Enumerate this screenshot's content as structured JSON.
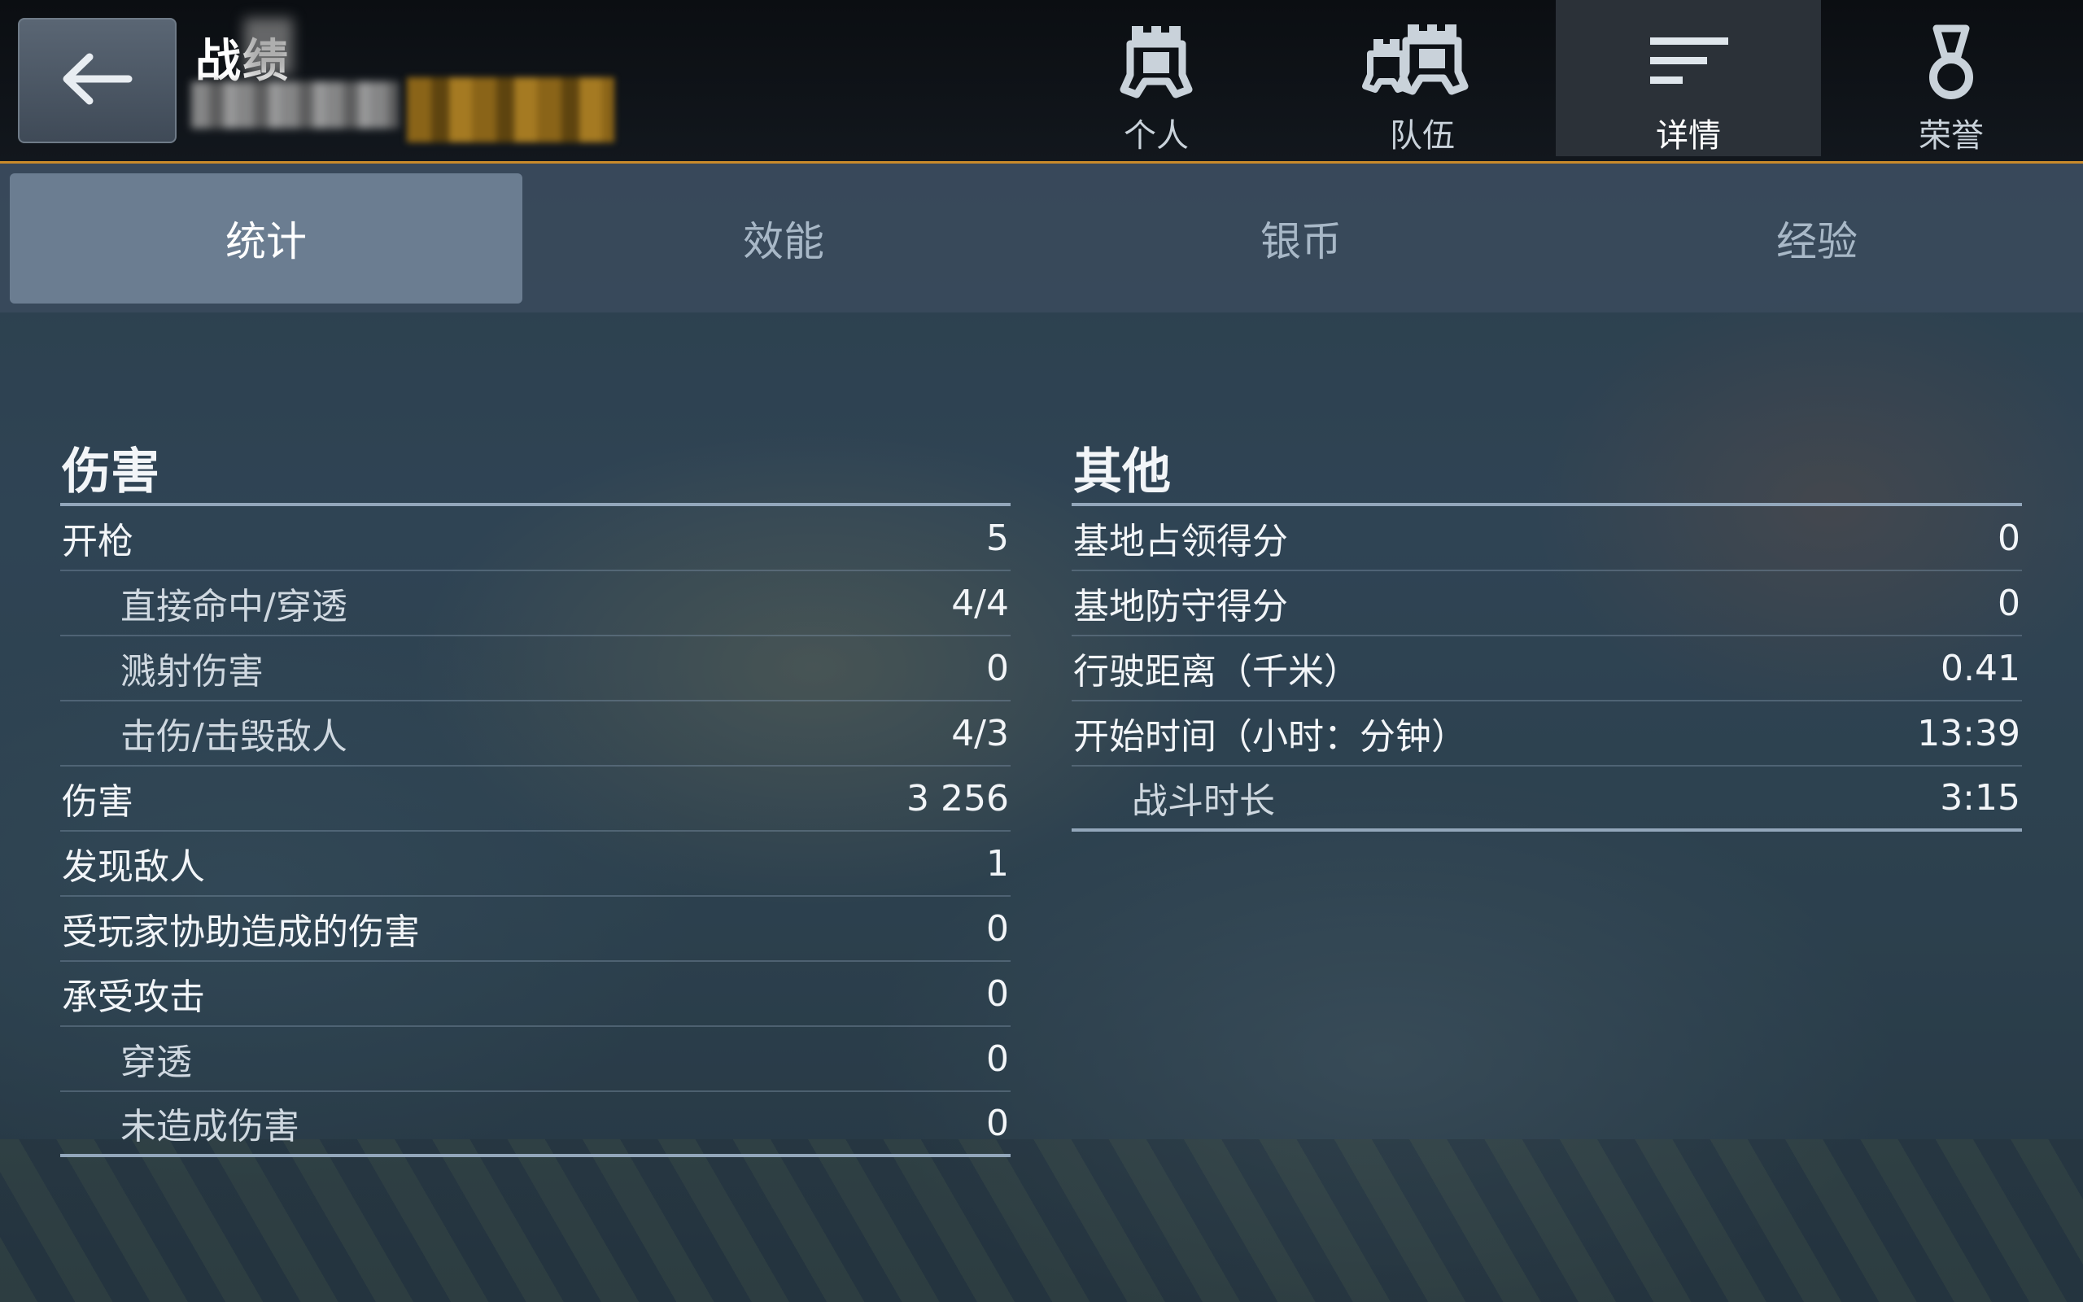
{
  "header": {
    "title": "战绩",
    "back_label": "",
    "tabs": [
      {
        "label": "个人",
        "icon": "single-player-helmet-icon",
        "active": false
      },
      {
        "label": "队伍",
        "icon": "team-helmets-icon",
        "active": false
      },
      {
        "label": "详情",
        "icon": "details-lines-icon",
        "active": true
      },
      {
        "label": "荣誉",
        "icon": "medal-icon",
        "active": false
      }
    ]
  },
  "subtabs": [
    {
      "label": "统计",
      "active": true
    },
    {
      "label": "效能",
      "active": false
    },
    {
      "label": "银币",
      "active": false
    },
    {
      "label": "经验",
      "active": false
    }
  ],
  "damage_section": {
    "title": "伤害",
    "rows": [
      {
        "label": "开枪",
        "value": "5",
        "indent": false
      },
      {
        "label": "直接命中/穿透",
        "value": "4/4",
        "indent": true
      },
      {
        "label": "溅射伤害",
        "value": "0",
        "indent": true
      },
      {
        "label": "击伤/击毁敌人",
        "value": "4/3",
        "indent": true
      },
      {
        "label": "伤害",
        "value": "3 256",
        "indent": false
      },
      {
        "label": "发现敌人",
        "value": "1",
        "indent": false
      },
      {
        "label": "受玩家协助造成的伤害",
        "value": "0",
        "indent": false
      },
      {
        "label": "承受攻击",
        "value": "0",
        "indent": false
      },
      {
        "label": "穿透",
        "value": "0",
        "indent": true
      },
      {
        "label": "未造成伤害",
        "value": "0",
        "indent": true
      }
    ]
  },
  "other_section": {
    "title": "其他",
    "rows": [
      {
        "label": "基地占领得分",
        "value": "0",
        "indent": false
      },
      {
        "label": "基地防守得分",
        "value": "0",
        "indent": false
      },
      {
        "label": "行驶距离（千米）",
        "value": "0.41",
        "indent": false
      },
      {
        "label": "开始时间（小时：分钟）",
        "value": "13:39",
        "indent": false
      },
      {
        "label": "战斗时长",
        "value": "3:15",
        "indent": true
      }
    ]
  },
  "colors": {
    "accent_orange": "#c98a2a",
    "header_bg": "#0b0e12",
    "subtab_active": "#6b7d91",
    "divider": "#93a7bb"
  }
}
